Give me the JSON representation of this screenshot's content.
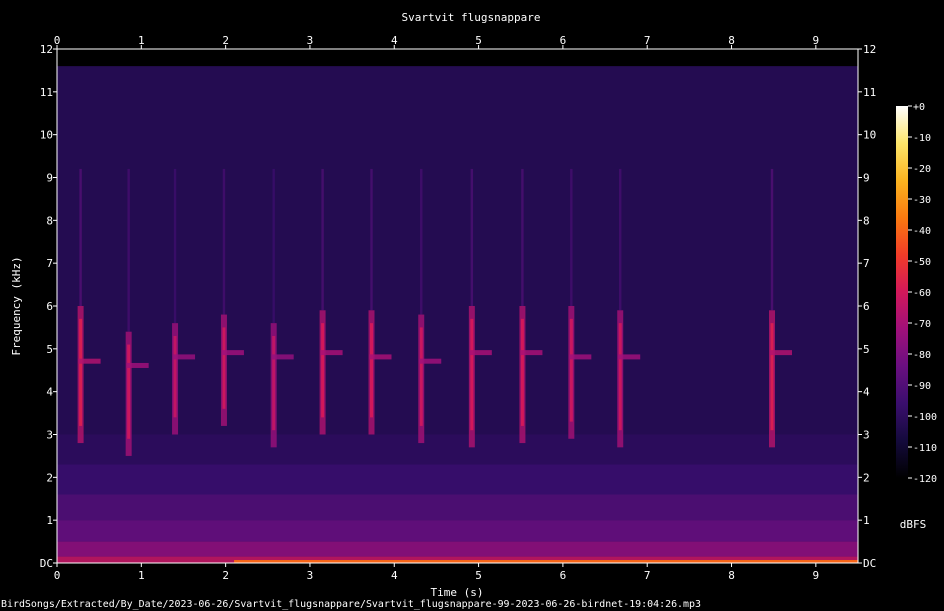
{
  "chart_data": {
    "type": "heatmap",
    "title": "Svartvit flugsnappare",
    "xlabel": "Time (s)",
    "ylabel": "Frequency (kHz)",
    "xlim": [
      0,
      9.5
    ],
    "ylim": [
      0,
      12
    ],
    "x_ticks": [
      "0",
      "1",
      "2",
      "3",
      "4",
      "5",
      "6",
      "7",
      "8",
      "9"
    ],
    "y_ticks": [
      "DC",
      "1",
      "2",
      "3",
      "4",
      "5",
      "6",
      "7",
      "8",
      "9",
      "10",
      "11",
      "12"
    ],
    "colorbar": {
      "label": "dBFS",
      "range": [
        -120,
        0
      ],
      "ticks": [
        "+0",
        "-10",
        "-20",
        "-30",
        "-40",
        "-50",
        "-60",
        "-70",
        "-80",
        "-90",
        "-100",
        "-110",
        "-120"
      ],
      "colors": [
        "#000000",
        "#140a3c",
        "#3a0e6e",
        "#6a0f80",
        "#a0107a",
        "#d2185a",
        "#f23c28",
        "#fa7a10",
        "#fbb420",
        "#fde66a",
        "#ffffff"
      ]
    },
    "background_level_dbfs": -105,
    "calls": [
      {
        "t": 0.28,
        "f_low": 2.8,
        "f_high": 6.0,
        "peak_khz": 4.7,
        "level_dbfs": -58
      },
      {
        "t": 0.85,
        "f_low": 2.5,
        "f_high": 5.4,
        "peak_khz": 4.6,
        "level_dbfs": -62
      },
      {
        "t": 1.4,
        "f_low": 3.0,
        "f_high": 5.6,
        "peak_khz": 4.8,
        "level_dbfs": -64
      },
      {
        "t": 1.98,
        "f_low": 3.2,
        "f_high": 5.8,
        "peak_khz": 4.9,
        "level_dbfs": -62
      },
      {
        "t": 2.57,
        "f_low": 2.7,
        "f_high": 5.6,
        "peak_khz": 4.8,
        "level_dbfs": -65
      },
      {
        "t": 3.15,
        "f_low": 3.0,
        "f_high": 5.9,
        "peak_khz": 4.9,
        "level_dbfs": -60
      },
      {
        "t": 3.73,
        "f_low": 3.0,
        "f_high": 5.9,
        "peak_khz": 4.8,
        "level_dbfs": -60
      },
      {
        "t": 4.32,
        "f_low": 2.8,
        "f_high": 5.8,
        "peak_khz": 4.7,
        "level_dbfs": -62
      },
      {
        "t": 4.92,
        "f_low": 2.7,
        "f_high": 6.0,
        "peak_khz": 4.9,
        "level_dbfs": -60
      },
      {
        "t": 5.52,
        "f_low": 2.8,
        "f_high": 6.0,
        "peak_khz": 4.9,
        "level_dbfs": -60
      },
      {
        "t": 6.1,
        "f_low": 2.9,
        "f_high": 6.0,
        "peak_khz": 4.8,
        "level_dbfs": -62
      },
      {
        "t": 6.68,
        "f_low": 2.7,
        "f_high": 5.9,
        "peak_khz": 4.8,
        "level_dbfs": -62
      },
      {
        "t": 8.48,
        "f_low": 2.7,
        "f_high": 5.9,
        "peak_khz": 4.9,
        "level_dbfs": -58
      }
    ]
  },
  "footer": {
    "file_path": "BirdSongs/Extracted/By_Date/2023-06-26/Svartvit_flugsnappare/Svartvit_flugsnappare-99-2023-06-26-birdnet-19:04:26.mp3"
  }
}
